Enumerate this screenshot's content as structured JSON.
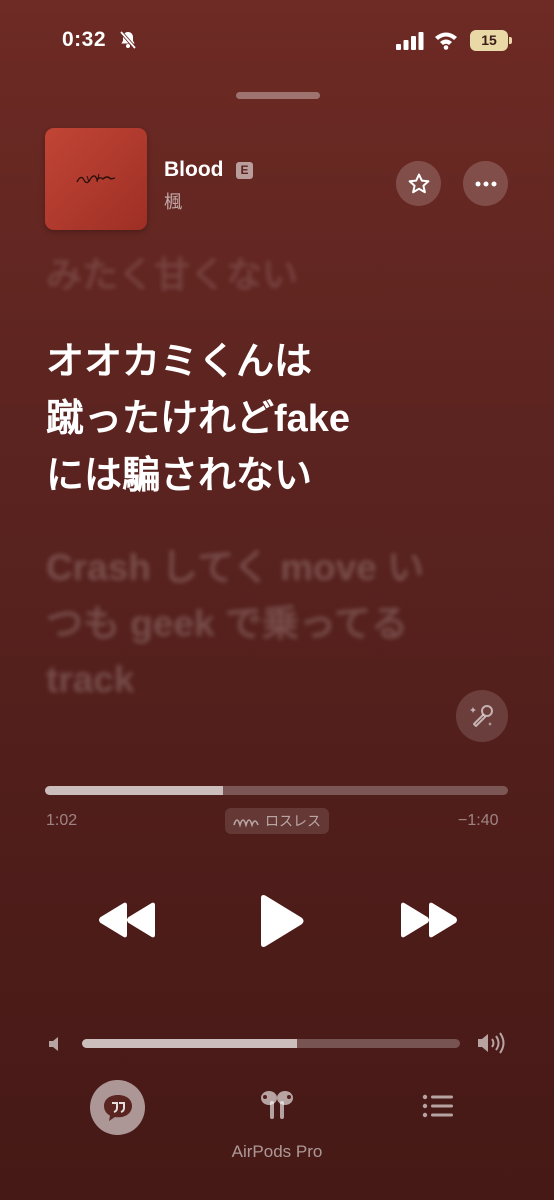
{
  "status_bar": {
    "time": "0:32",
    "battery": "15"
  },
  "now_playing": {
    "title": "Blood",
    "explicit_badge": "E",
    "artist": "楓"
  },
  "lyrics": {
    "previous": "みたく甘くない",
    "current": [
      "オオカミくんは",
      "蹴ったけれどfake",
      "には騙されない"
    ],
    "next": [
      "Crash してく move い",
      "つも geek で乗ってる",
      "track"
    ]
  },
  "playback": {
    "elapsed": "1:02",
    "remaining": "−1:40",
    "progress_fraction": 0.385,
    "quality_badge": "ロスレス"
  },
  "volume": {
    "level_fraction": 0.57
  },
  "bottom_bar": {
    "output_device": "AirPods Pro"
  },
  "icons": [
    "bell-slash-icon",
    "signal-icon",
    "wifi-icon",
    "battery-icon",
    "star-icon",
    "more-icon",
    "sing-icon",
    "lossless-icon",
    "rewind-icon",
    "play-icon",
    "fast-forward-icon",
    "volume-low-icon",
    "volume-high-icon",
    "lyrics-icon",
    "airpods-icon",
    "queue-icon"
  ],
  "colors": {
    "background": "#5c2420",
    "accent": "#ffffff",
    "battery": "#e8d9a6"
  }
}
